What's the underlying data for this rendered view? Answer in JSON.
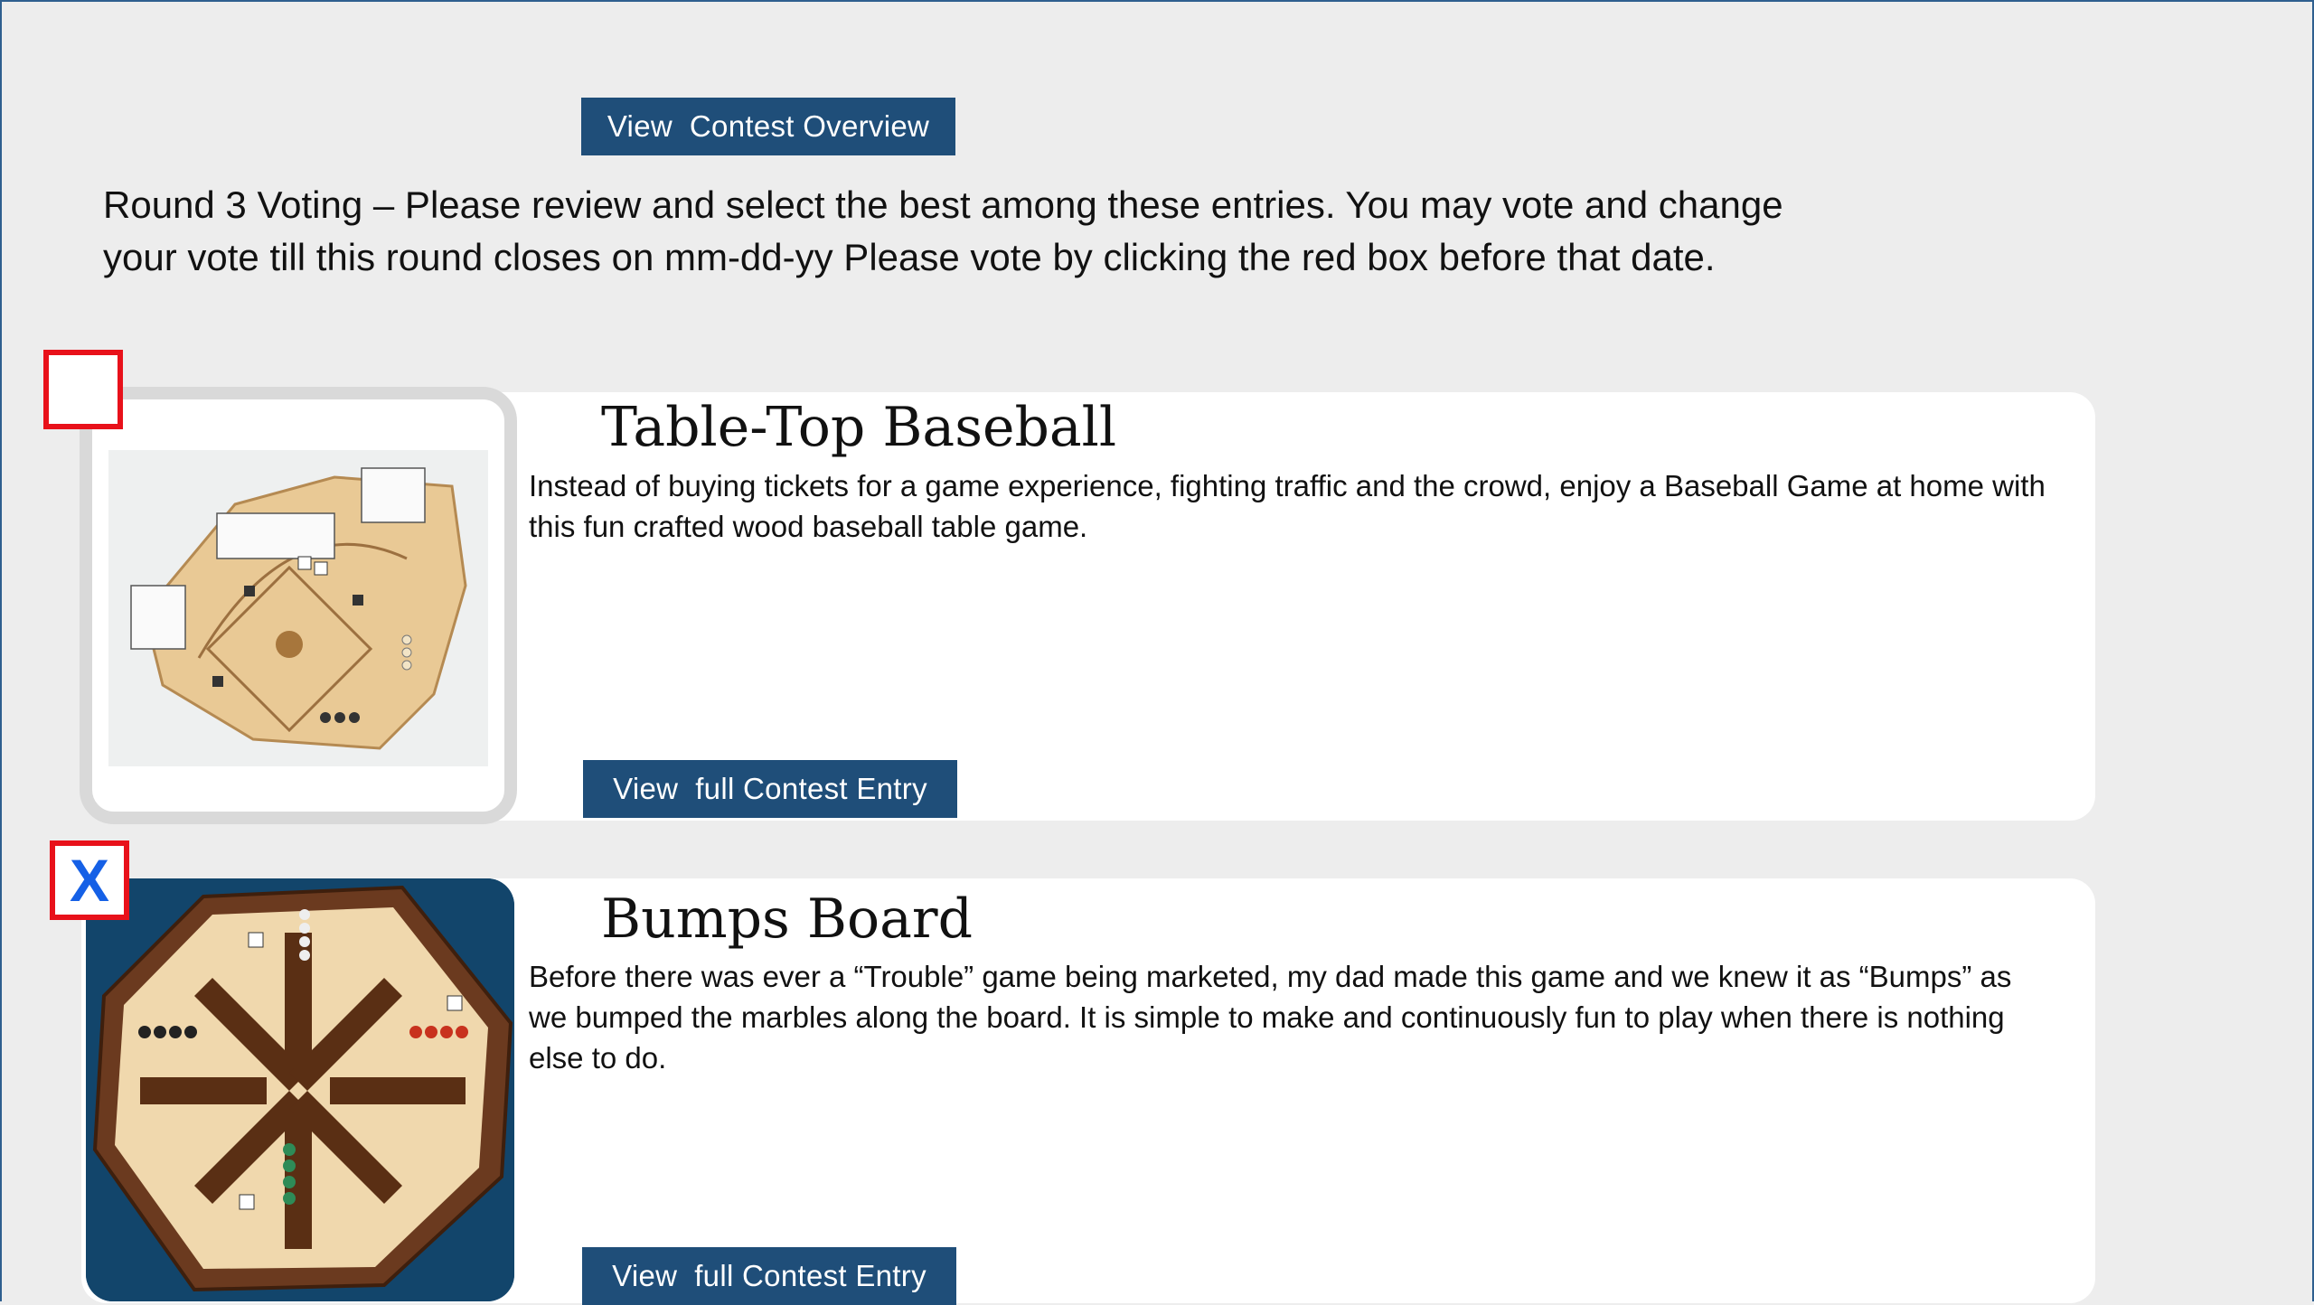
{
  "header": {
    "overview_button": "View  Contest Overview"
  },
  "intro": {
    "line1": "Round 3 Voting – Please review and select the best among these entries. You may vote and change",
    "line2": "your vote till this round closes on mm-dd-yy Please vote by clicking the red box before that date."
  },
  "entries": [
    {
      "title": "Table-Top Baseball",
      "description": "Instead of buying tickets for a game experience, fighting traffic and the crowd, enjoy a Baseball Game at home with this fun crafted wood baseball table game.",
      "button": "View  full Contest Entry",
      "vote_mark": ""
    },
    {
      "title": "Bumps Board",
      "description": "Before there was ever a “Trouble” game being marketed, my dad made this game and we knew it as “Bumps” as we bumped the marbles along the board. It is simple to make and continuously fun to play when there is nothing else to do.",
      "button": "View  full Contest Entry",
      "vote_mark": "X"
    }
  ],
  "colors": {
    "button_bg": "#1f4e79",
    "vote_border": "#e8111a",
    "vote_mark": "#1560e6"
  }
}
